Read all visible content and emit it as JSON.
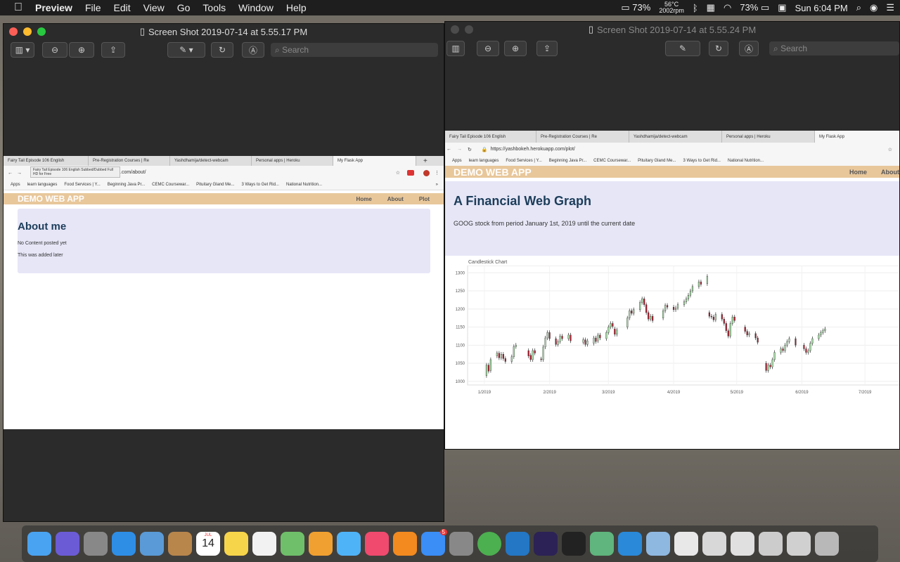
{
  "menubar": {
    "apple": "",
    "items": [
      "Preview",
      "File",
      "Edit",
      "View",
      "Go",
      "Tools",
      "Window",
      "Help"
    ],
    "status": {
      "battery_pct": "73%",
      "temp": "56°C",
      "rpm": "2002rpm",
      "wifi_battery": "73%",
      "clock": "Sun 6:04 PM"
    }
  },
  "left_window": {
    "title": "Screen Shot 2019-07-14 at 5.55.17 PM",
    "search_placeholder": "Search",
    "browser": {
      "tabs": [
        "Fairy Tail Episode 106 English",
        "Pre-Registration Courses | Re",
        "Yashdhamija/detect-webcam",
        "Personal apps | Heroku",
        "My Flask App"
      ],
      "tooltip": "Fairy Tail Episode 106 English Subbed/Dubbed Full HD for Free",
      "url": ".com/about/",
      "bookmarks": [
        "Apps",
        "learn languages",
        "Food Services | Y...",
        "Beginning Java Pr...",
        "CEMC Coursewar...",
        "Pituitary Gland Me...",
        "3 Ways to Get Rid...",
        "National Nutrition..."
      ],
      "brand": "DEMO WEB APP",
      "nav": [
        "Home",
        "About",
        "Plot"
      ],
      "heading": "About me",
      "lines": [
        "No Content posted yet",
        "This was added later"
      ]
    }
  },
  "right_window": {
    "title": "Screen Shot 2019-07-14 at 5.55.24 PM",
    "search_placeholder": "Search",
    "browser": {
      "tabs": [
        "Fairy Tail Episode 106 English",
        "Pre-Registration Courses | Re",
        "Yashdhamija/detect-webcam",
        "Personal apps | Heroku",
        "My Flask App"
      ],
      "url": "https://yashbokeh.herokuapp.com/plot/",
      "bookmarks": [
        "Apps",
        "learn languages",
        "Food Services | Y...",
        "Beginning Java Pr...",
        "CEMC Coursewar...",
        "Pituitary Gland Me...",
        "3 Ways to Get Rid...",
        "National Nutrition..."
      ],
      "brand": "DEMO WEB APP",
      "nav": [
        "Home",
        "About"
      ],
      "heading": "A Financial Web Graph",
      "subtitle": "GOOG stock from period January 1st, 2019 until the current date"
    }
  },
  "chart_data": {
    "type": "candlestick",
    "title": "Candlestick Chart",
    "ylim": [
      990,
      1320
    ],
    "yticks": [
      "1000",
      "1050",
      "1100",
      "1150",
      "1200",
      "1250",
      "1300"
    ],
    "xticks": [
      "1/2019",
      "2/2019",
      "3/2019",
      "4/2019",
      "5/2019",
      "6/2019",
      "7/2019"
    ],
    "xtick_days": [
      0,
      31,
      59,
      90,
      120,
      151,
      181
    ],
    "xlim_days": [
      -8,
      198
    ],
    "grid": true,
    "colors": {
      "up": "#a9e2a9",
      "down": "#b2182b",
      "wick": "#333333"
    },
    "candles": [
      [
        1,
        1016,
        1045
      ],
      [
        2,
        1045,
        1028
      ],
      [
        3,
        1030,
        1060
      ],
      [
        6,
        1070,
        1078
      ],
      [
        7,
        1078,
        1065
      ],
      [
        8,
        1065,
        1075
      ],
      [
        9,
        1075,
        1063
      ],
      [
        10,
        1063,
        1055
      ],
      [
        13,
        1055,
        1068
      ],
      [
        14,
        1068,
        1096
      ],
      [
        15,
        1096,
        1100
      ],
      [
        21,
        1085,
        1070
      ],
      [
        22,
        1072,
        1060
      ],
      [
        23,
        1060,
        1085
      ],
      [
        24,
        1085,
        1078
      ],
      [
        27,
        1062,
        1060
      ],
      [
        28,
        1060,
        1095
      ],
      [
        29,
        1095,
        1120
      ],
      [
        30,
        1120,
        1135
      ],
      [
        31,
        1135,
        1118
      ],
      [
        34,
        1118,
        1102
      ],
      [
        35,
        1102,
        1110
      ],
      [
        36,
        1110,
        1125
      ],
      [
        37,
        1125,
        1118
      ],
      [
        40,
        1118,
        1128
      ],
      [
        41,
        1128,
        1112
      ],
      [
        47,
        1108,
        1115
      ],
      [
        48,
        1115,
        1102
      ],
      [
        49,
        1102,
        1112
      ],
      [
        52,
        1105,
        1120
      ],
      [
        53,
        1120,
        1110
      ],
      [
        54,
        1112,
        1128
      ],
      [
        55,
        1128,
        1120
      ],
      [
        58,
        1118,
        1135
      ],
      [
        59,
        1135,
        1150
      ],
      [
        60,
        1150,
        1160
      ],
      [
        61,
        1160,
        1152
      ],
      [
        62,
        1145,
        1130
      ],
      [
        63,
        1130,
        1142
      ],
      [
        68,
        1150,
        1175
      ],
      [
        69,
        1175,
        1195
      ],
      [
        70,
        1195,
        1188
      ],
      [
        71,
        1188,
        1198
      ],
      [
        74,
        1198,
        1218
      ],
      [
        75,
        1218,
        1228
      ],
      [
        76,
        1228,
        1212
      ],
      [
        77,
        1212,
        1190
      ],
      [
        78,
        1190,
        1172
      ],
      [
        79,
        1172,
        1180
      ],
      [
        80,
        1180,
        1168
      ],
      [
        85,
        1175,
        1195
      ],
      [
        86,
        1195,
        1210
      ],
      [
        87,
        1210,
        1205
      ],
      [
        90,
        1205,
        1198
      ],
      [
        91,
        1198,
        1203
      ],
      [
        92,
        1203,
        1212
      ],
      [
        95,
        1212,
        1220
      ],
      [
        96,
        1220,
        1228
      ],
      [
        97,
        1228,
        1238
      ],
      [
        98,
        1238,
        1250
      ],
      [
        99,
        1250,
        1262
      ],
      [
        102,
        1262,
        1275
      ],
      [
        103,
        1275,
        1268
      ],
      [
        106,
        1270,
        1290
      ],
      [
        107,
        1190,
        1180
      ],
      [
        108,
        1180,
        1178
      ],
      [
        109,
        1178,
        1170
      ],
      [
        110,
        1170,
        1185
      ],
      [
        113,
        1185,
        1172
      ],
      [
        114,
        1172,
        1160
      ],
      [
        115,
        1160,
        1140
      ],
      [
        116,
        1140,
        1125
      ],
      [
        117,
        1125,
        1160
      ],
      [
        118,
        1160,
        1178
      ],
      [
        119,
        1178,
        1168
      ],
      [
        124,
        1150,
        1138
      ],
      [
        125,
        1138,
        1128
      ],
      [
        126,
        1128,
        1132
      ],
      [
        129,
        1132,
        1120
      ],
      [
        130,
        1120,
        1108
      ],
      [
        134,
        1050,
        1030
      ],
      [
        135,
        1030,
        1045
      ],
      [
        136,
        1045,
        1040
      ],
      [
        137,
        1040,
        1060
      ],
      [
        138,
        1060,
        1080
      ],
      [
        141,
        1080,
        1090
      ],
      [
        142,
        1090,
        1085
      ],
      [
        143,
        1085,
        1100
      ],
      [
        144,
        1100,
        1110
      ],
      [
        145,
        1110,
        1118
      ],
      [
        148,
        1118,
        1100
      ],
      [
        152,
        1100,
        1090
      ],
      [
        153,
        1090,
        1080
      ],
      [
        154,
        1080,
        1085
      ],
      [
        155,
        1085,
        1105
      ],
      [
        156,
        1105,
        1118
      ],
      [
        159,
        1118,
        1128
      ],
      [
        160,
        1128,
        1135
      ],
      [
        161,
        1135,
        1140
      ],
      [
        162,
        1140,
        1145
      ]
    ]
  },
  "dock": {
    "items": [
      {
        "name": "finder",
        "color": "#4aa3f0"
      },
      {
        "name": "siri",
        "color": "#6b5cd6"
      },
      {
        "name": "launchpad",
        "color": "#888"
      },
      {
        "name": "safari",
        "color": "#2e8ee6"
      },
      {
        "name": "mail",
        "color": "#5a9ad6"
      },
      {
        "name": "contacts",
        "color": "#b8864b"
      },
      {
        "name": "calendar",
        "color": "#ffffff"
      },
      {
        "name": "notes",
        "color": "#f7d54a"
      },
      {
        "name": "reminders",
        "color": "#f2f2f2"
      },
      {
        "name": "maps",
        "color": "#6fbf6a"
      },
      {
        "name": "photos",
        "color": "#f0a030"
      },
      {
        "name": "messages",
        "color": "#4fb3f7"
      },
      {
        "name": "music",
        "color": "#f04a6e"
      },
      {
        "name": "books",
        "color": "#f28a1f"
      },
      {
        "name": "app-store",
        "color": "#3a8ef6",
        "badge": "5"
      },
      {
        "name": "system-preferences",
        "color": "#888"
      },
      {
        "name": "chrome",
        "color": "#4caf50"
      },
      {
        "name": "vscode",
        "color": "#2377c4"
      },
      {
        "name": "eclipse",
        "color": "#2c2255"
      },
      {
        "name": "terminal",
        "color": "#222"
      },
      {
        "name": "atom",
        "color": "#5fb57d"
      },
      {
        "name": "xcode",
        "color": "#2a89d8"
      },
      {
        "name": "preview",
        "color": "#8fb8e0"
      },
      {
        "name": "doc-thumb-1",
        "color": "#e8e8e8"
      },
      {
        "name": "doc-thumb-2",
        "color": "#d8d8d8"
      },
      {
        "name": "doc-thumb-3",
        "color": "#e0e0e0"
      },
      {
        "name": "doc-thumb-4",
        "color": "#ccc"
      },
      {
        "name": "doc-thumb-5",
        "color": "#d0d0d0"
      },
      {
        "name": "trash",
        "color": "#b8b8b8"
      }
    ],
    "calendar": {
      "month": "JUL",
      "day": "14"
    }
  }
}
